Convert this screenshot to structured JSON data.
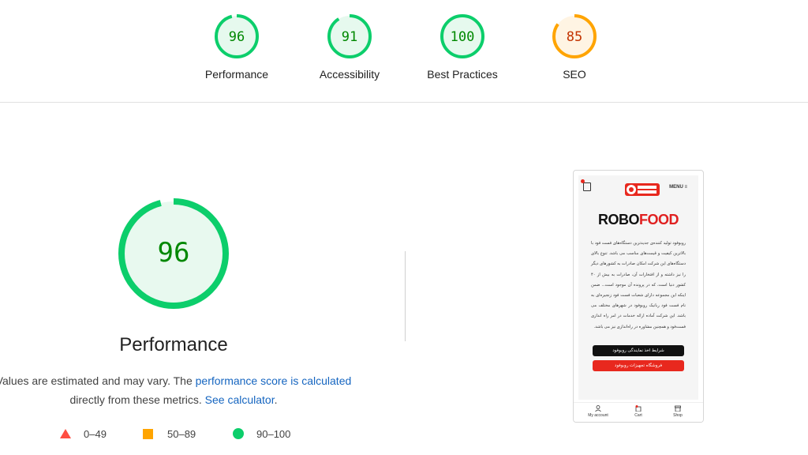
{
  "summary": {
    "gauges": [
      {
        "score": "96",
        "label": "Performance",
        "color": "#0cce6b",
        "bg": "#e6f9ee",
        "text_color": "#008800",
        "fraction": 0.96
      },
      {
        "score": "91",
        "label": "Accessibility",
        "color": "#0cce6b",
        "bg": "#e6f9ee",
        "text_color": "#008800",
        "fraction": 0.91
      },
      {
        "score": "100",
        "label": "Best Practices",
        "color": "#0cce6b",
        "bg": "#e6f9ee",
        "text_color": "#008800",
        "fraction": 1.0
      },
      {
        "score": "85",
        "label": "SEO",
        "color": "#ffa400",
        "bg": "#fff4e3",
        "text_color": "#c33300",
        "fraction": 0.85
      }
    ]
  },
  "performance": {
    "score": "96",
    "fraction": 0.96,
    "title": "Performance",
    "desc_prefix": "Values are estimated and may vary. The ",
    "desc_link": "performance score is calculated",
    "desc_mid": " directly from these metrics. ",
    "desc_link2": "See calculator",
    "desc_suffix": ".",
    "colors": {
      "pass": "#0cce6b",
      "pass_bg": "#e8f9ef",
      "pass_text": "#008800",
      "average": "#ffa400",
      "fail": "#ff4e42"
    }
  },
  "legend": [
    {
      "range": "0–49",
      "shape": "triangle",
      "color": "#ff4e42"
    },
    {
      "range": "50–89",
      "shape": "square",
      "color": "#ffa400"
    },
    {
      "range": "90–100",
      "shape": "circle",
      "color": "#0cce6b"
    }
  ],
  "screenshot": {
    "menu": "MENU ≡",
    "brand_robo": "ROBO",
    "brand_food": "FOOD",
    "paragraph": "روبوفود تولید کننده‌ی جدیدترین دستگاه‌های فست فود با بالاترین کیفیت و قیمت‌های مناسب می باشد. تنوع بالای دستگاه‌های این شرکت امکان صادرات به کشورهای دیگر را نیز داشته و از افتخارات آن، صادرات به بیش از ۴۰ کشور دنیا است، که در پرونده آن موجود است... ضمن اینکه این مجموعه دارای شعبات فست فود زنجیره‌ای به نام فست فود ربانیک روبوفود در شهرهای مختلف می باشد. این شرکت آماده ارائه خدمات در امر راه اندازی فست‌فود و همچنین مشاوره در راه‌اندازی نیز می باشد.",
    "btn_black": "شرایط اخذ نمایندگی روبوفود",
    "btn_red": "فروشگاه تجهیزات روبوفود",
    "nav": [
      {
        "label": "My account"
      },
      {
        "label": "Cart"
      },
      {
        "label": "Shop"
      }
    ]
  }
}
